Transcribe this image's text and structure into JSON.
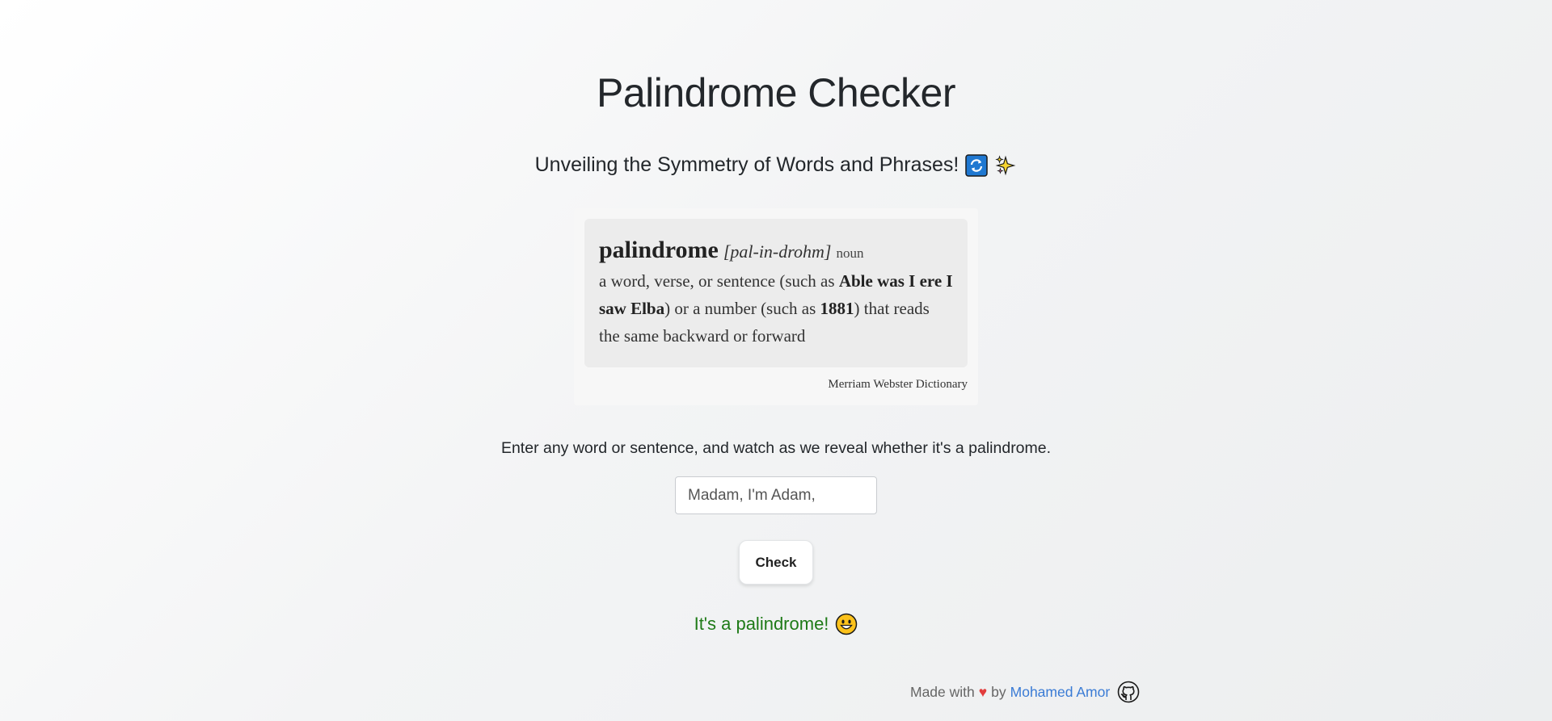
{
  "header": {
    "title": "Palindrome Checker",
    "subtitle": "Unveiling the Symmetry of Words and Phrases!",
    "subtitle_icons": [
      "repeat-button-emoji",
      "sparkles-emoji"
    ]
  },
  "definition": {
    "word": "palindrome",
    "pronunciation": "[pal-in-drohm]",
    "part_of_speech": "noun",
    "text_1": "a word, verse, or sentence (such as ",
    "example_1": "Able was I ere I saw Elba",
    "text_2": ") or a number (such as ",
    "example_2": "1881",
    "text_3": ") that reads the same backward or forward",
    "source": "Merriam Webster Dictionary"
  },
  "checker": {
    "instructions": "Enter any word or sentence, and watch as we reveal whether it's a palindrome.",
    "input_value": "Madam, I'm Adam,",
    "button_label": "Check",
    "result": "It's a palindrome!",
    "result_icon": "grinning-face-emoji",
    "result_color": "#1e7a17"
  },
  "footer": {
    "made_with": "Made with",
    "heart": "♥",
    "by": "by",
    "author": "Mohamed Amor",
    "link_color": "#3a7bd5",
    "icon": "github-icon"
  }
}
